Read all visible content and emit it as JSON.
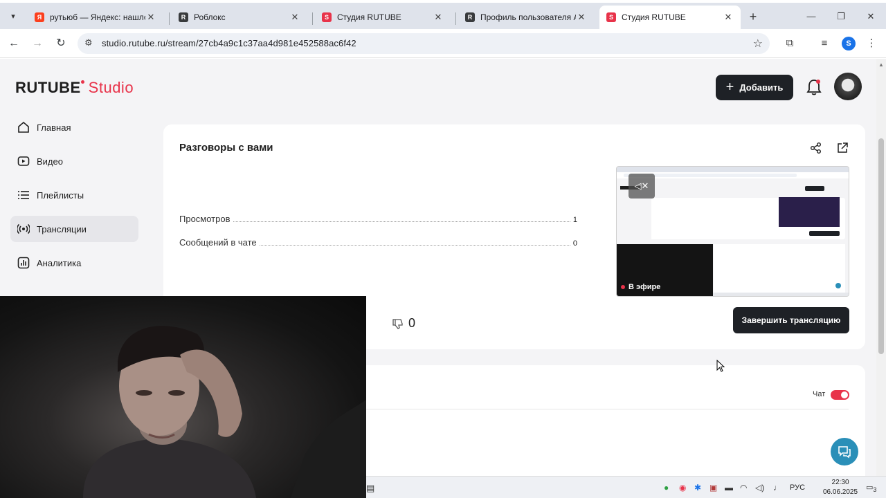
{
  "browser": {
    "tabs": [
      {
        "title": "рутьюб — Яндекс: нашлос",
        "favicon": "yandex-icon",
        "color": "#fc3f1d"
      },
      {
        "title": "Роблокс",
        "favicon": "roblox-icon",
        "color": "#393b3d"
      },
      {
        "title": "Студия RUTUBE",
        "favicon": "rutube-icon",
        "color": "#e8334a"
      },
      {
        "title": "Профиль пользователя Ar",
        "favicon": "roblox-icon",
        "color": "#393b3d"
      },
      {
        "title": "Студия RUTUBE",
        "favicon": "rutube-icon",
        "color": "#e8334a",
        "active": true
      }
    ],
    "url": "studio.rutube.ru/stream/27cb4a9c1c37aa4d981e452588ac6f42",
    "profile_letter": "S"
  },
  "header": {
    "logo_main": "RUTUBE",
    "logo_sub": "Studio",
    "add_button": "Добавить"
  },
  "sidebar": {
    "items": [
      {
        "label": "Главная",
        "icon": "home-icon"
      },
      {
        "label": "Видео",
        "icon": "video-icon"
      },
      {
        "label": "Плейлисты",
        "icon": "playlist-icon"
      },
      {
        "label": "Трансляции",
        "icon": "broadcast-icon",
        "active": true
      },
      {
        "label": "Аналитика",
        "icon": "analytics-icon"
      }
    ]
  },
  "stream": {
    "title": "Разговоры с вами",
    "stats": [
      {
        "label": "Просмотров",
        "value": "1"
      },
      {
        "label": "Сообщений в чате",
        "value": "0"
      }
    ],
    "live_badge": "В эфире",
    "dislikes": "0",
    "end_button": "Завершить трансляцию"
  },
  "chat": {
    "label": "Чат",
    "enabled": true
  },
  "taskbar": {
    "language": "РУС",
    "time": "22:30",
    "date": "06.06.2025",
    "notifications": "3"
  },
  "colors": {
    "accent": "#e8334a",
    "dark_button": "#1e2126",
    "help_button": "#2a8fb8"
  }
}
